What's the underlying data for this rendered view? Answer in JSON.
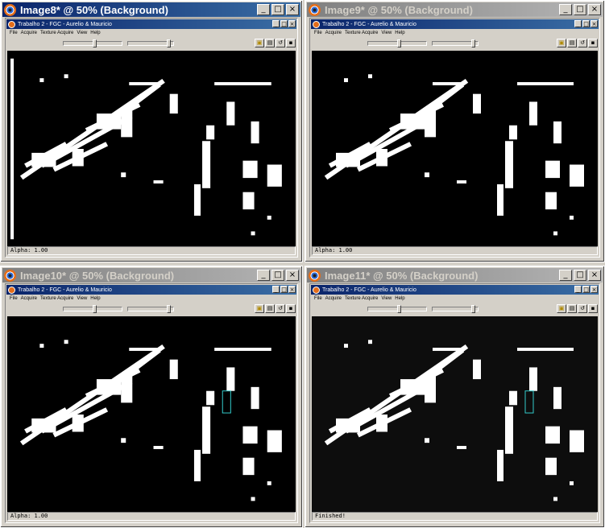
{
  "windows": [
    {
      "id": "w1",
      "title": "Image8* @  50% (Background)",
      "active": true,
      "inner_title": "Trabalho 2 - FGC - Aurelio & Mauricio",
      "status": "Alpha: 1.00"
    },
    {
      "id": "w2",
      "title": "Image9* @  50% (Background)",
      "active": false,
      "inner_title": "Trabalho 2 - FGC - Aurelio & Mauricio",
      "status": "Alpha: 1.00"
    },
    {
      "id": "w3",
      "title": "Image10* @  50% (Background)",
      "active": false,
      "inner_title": "Trabalho 2 - FGC - Aurelio & Mauricio",
      "status": "Alpha: 1.00"
    },
    {
      "id": "w4",
      "title": "Image11* @  50% (Background)",
      "active": false,
      "inner_title": "Trabalho 2 - FGC - Aurelio & Mauricio",
      "status": "Finished!"
    }
  ],
  "menu": {
    "file": "File",
    "acquire": "Acquire",
    "texture": "Texture Acquire",
    "view": "View",
    "help": "Help"
  },
  "caption_buttons": {
    "minimize": "_",
    "maximize": "□",
    "close": "×"
  },
  "colors": {
    "active_title": "#0a246a",
    "inactive_title": "#808080",
    "canvas": "#000000",
    "pixels": "#ffffff"
  }
}
